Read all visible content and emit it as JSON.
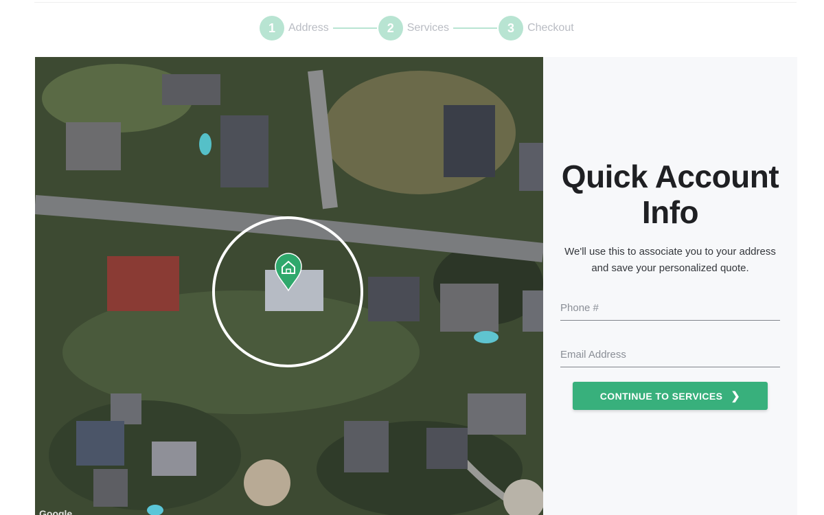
{
  "stepper": {
    "steps": [
      {
        "number": "1",
        "label": "Address"
      },
      {
        "number": "2",
        "label": "Services"
      },
      {
        "number": "3",
        "label": "Checkout"
      }
    ],
    "color": "#b8e4d2"
  },
  "map": {
    "marker_icon": "home-pin-icon",
    "marker_color": "#2fa86c",
    "watermark": "Google"
  },
  "form": {
    "title": "Quick Account Info",
    "subtitle": "We'll use this to associate you to your address and save your personalized quote.",
    "phone_placeholder": "Phone #",
    "email_placeholder": "Email Address",
    "cta_label": "CONTINUE TO SERVICES",
    "cta_color": "#38b07c"
  }
}
